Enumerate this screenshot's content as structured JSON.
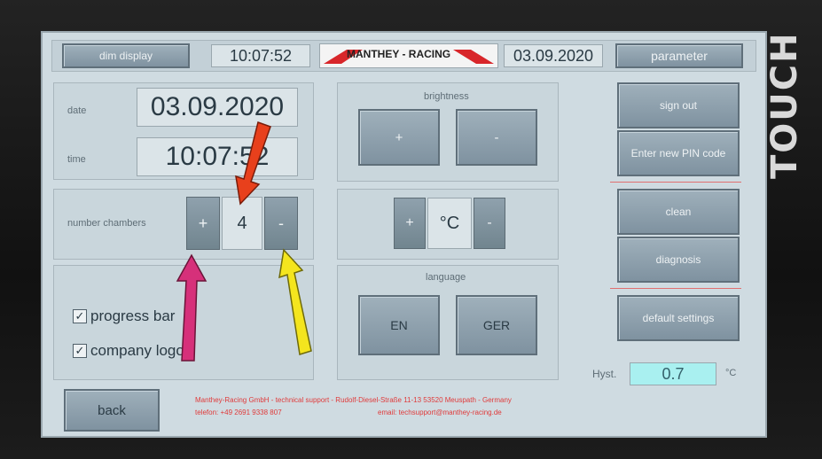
{
  "device": {
    "side_label": "TOUCH"
  },
  "header": {
    "dim_display_label": "dim display",
    "clock": "10:07:52",
    "brand": "MANTHEY - RACING",
    "date": "03.09.2020",
    "parameter_label": "parameter"
  },
  "datetime_panel": {
    "date_label": "date",
    "date_value": "03.09.2020",
    "time_label": "time",
    "time_value": "10:07:52"
  },
  "chambers": {
    "label": "number  chambers",
    "plus": "+",
    "value": "4",
    "minus": "-"
  },
  "options": {
    "progress_bar": {
      "label": "progress bar",
      "checked": "✓"
    },
    "company_logo": {
      "label": "company logo",
      "checked": "✓"
    }
  },
  "brightness": {
    "title": "brightness",
    "plus": "+",
    "minus": "-"
  },
  "temperature_unit": {
    "plus": "+",
    "value": "°C",
    "minus": "-"
  },
  "language": {
    "title": "language",
    "en": "EN",
    "ger": "GER"
  },
  "right_buttons": {
    "sign_out": "sign out",
    "enter_pin": "Enter new PIN code",
    "clean": "clean",
    "diagnosis": "diagnosis",
    "default_settings": "default settings"
  },
  "hyst": {
    "label": "Hyst.",
    "value": "0.7",
    "unit": "°C"
  },
  "back_label": "back",
  "footer": {
    "line1": "Manthey-Racing GmbH - technical support - Rudolf-Diesel-Straße 11-13 53520 Meuspath - Germany",
    "phone": "telefon: +49 2691 9338 807",
    "email": "email: techsupport@manthey-racing.de"
  },
  "colors": {
    "accent_red": "#e03a3a",
    "arrow_red": "#e8401c",
    "arrow_pink": "#d6307a",
    "arrow_yellow": "#f4e51e",
    "hyst_field": "#a9f0f0"
  }
}
